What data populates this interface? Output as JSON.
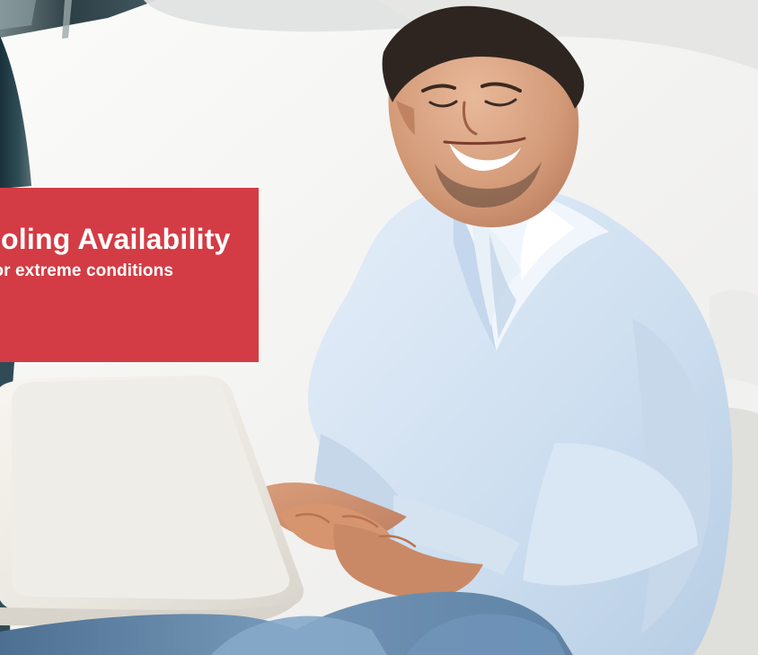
{
  "hero": {
    "title": "Cooling Availability",
    "subtitle": "for extreme conditions",
    "accent_color": "#d33c45"
  }
}
